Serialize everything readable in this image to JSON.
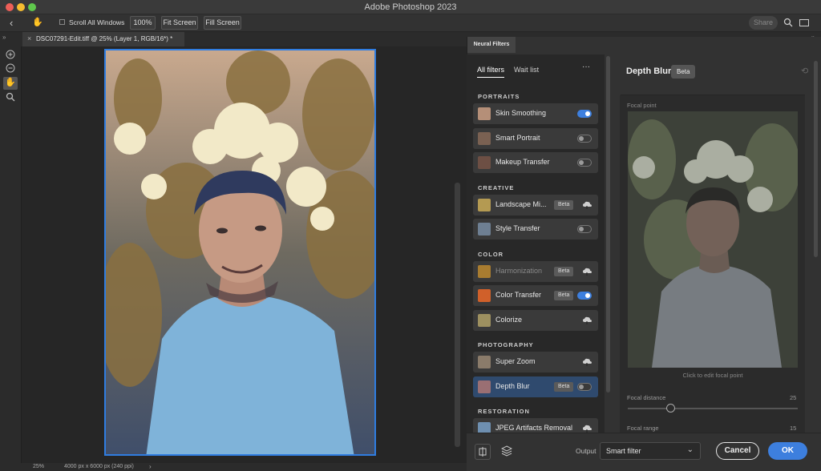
{
  "app": {
    "title": "Adobe Photoshop 2023"
  },
  "options_bar": {
    "scroll_all_windows": "Scroll All Windows",
    "zoom_100": "100%",
    "fit_screen": "Fit Screen",
    "fill_screen": "Fill Screen",
    "share": "Share"
  },
  "document": {
    "tab_title": "DSC07291-Edit.tiff @ 25% (Layer 1, RGB/16*) *"
  },
  "status": {
    "zoom": "25%",
    "dimensions": "4000 px x 6000 px (240 ppi)"
  },
  "neural_filters": {
    "panel_tab": "Neural Filters",
    "tabs": [
      "All filters",
      "Wait list"
    ],
    "more": "···",
    "sections": [
      {
        "title": "PORTRAITS",
        "items": [
          {
            "label": "Skin Smoothing",
            "control": "toggle",
            "on": true
          },
          {
            "label": "Smart Portrait",
            "control": "toggle",
            "on": false
          },
          {
            "label": "Makeup Transfer",
            "control": "toggle",
            "on": false
          }
        ]
      },
      {
        "title": "CREATIVE",
        "items": [
          {
            "label": "Landscape Mi...",
            "badge": "Beta",
            "control": "cloud"
          },
          {
            "label": "Style Transfer",
            "control": "toggle",
            "on": false
          }
        ]
      },
      {
        "title": "COLOR",
        "items": [
          {
            "label": "Harmonization",
            "badge": "Beta",
            "control": "cloud",
            "dim": true
          },
          {
            "label": "Color Transfer",
            "badge": "Beta",
            "control": "toggle",
            "on": true
          },
          {
            "label": "Colorize",
            "control": "cloud"
          }
        ]
      },
      {
        "title": "PHOTOGRAPHY",
        "items": [
          {
            "label": "Super Zoom",
            "control": "cloud"
          },
          {
            "label": "Depth Blur",
            "badge": "Beta",
            "control": "toggle",
            "on": false,
            "selected": true
          }
        ]
      },
      {
        "title": "RESTORATION",
        "items": [
          {
            "label": "JPEG Artifacts Removal",
            "control": "cloud"
          }
        ]
      }
    ]
  },
  "detail": {
    "title": "Depth Blur",
    "badge": "Beta",
    "focal_point_label": "Focal point",
    "preview_caption": "Click to edit focal point",
    "focal_distance_label": "Focal distance",
    "focal_distance_value": "25",
    "focal_range_label": "Focal range",
    "focal_range_value": "15",
    "focal_distance_fraction": 0.25
  },
  "footer": {
    "output_label": "Output",
    "output_value": "Smart filter",
    "cancel": "Cancel",
    "ok": "OK"
  },
  "colors": {
    "accent": "#3d7fde",
    "selection_border": "#2f7de1"
  }
}
